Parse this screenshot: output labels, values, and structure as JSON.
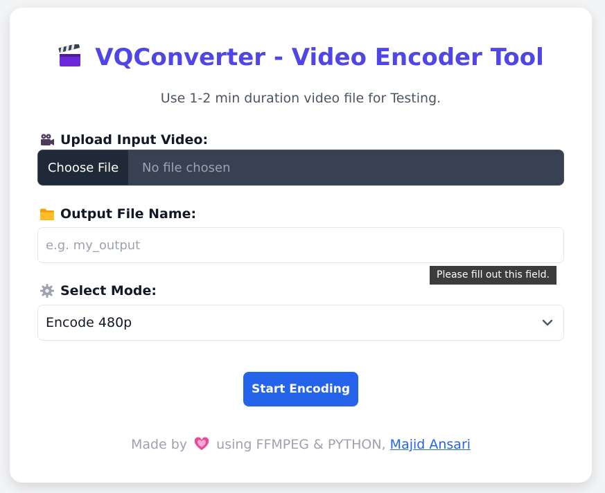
{
  "header": {
    "title": "VQConverter - Video Encoder Tool",
    "title_icon": "clapperboard-icon",
    "subtitle": "Use 1-2 min duration video file for Testing."
  },
  "upload": {
    "label": "Upload Input Video:",
    "icon": "video-camera-icon",
    "button_label": "Choose File",
    "status": "No file chosen"
  },
  "output": {
    "label": "Output File Name:",
    "icon": "folder-icon",
    "placeholder": "e.g. my_output",
    "value": ""
  },
  "validation": {
    "message": "Please fill out this field."
  },
  "mode": {
    "label": "Select Mode:",
    "icon": "gear-icon",
    "selected": "Encode 480p"
  },
  "actions": {
    "start_label": "Start Encoding"
  },
  "footer": {
    "prefix": "Made by",
    "heart_icon": "heart-icon",
    "middle": "using FFMPEG & PYTHON,",
    "author_link": "Majid Ansari"
  },
  "colors": {
    "accent": "#4f46e5",
    "primary_button": "#2563eb",
    "file_input_bg": "#374151"
  }
}
